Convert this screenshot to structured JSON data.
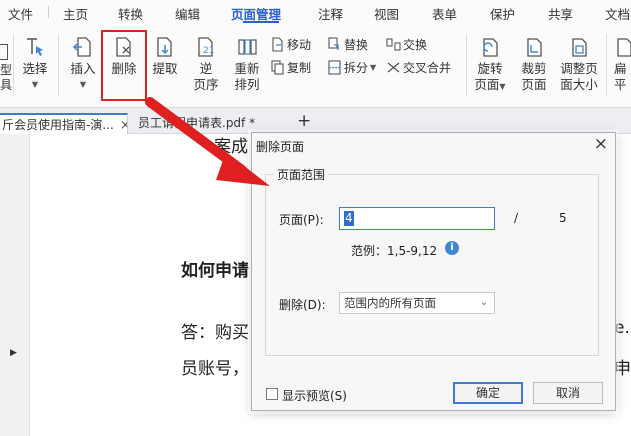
{
  "menu": {
    "items": [
      "文件",
      "主页",
      "转换",
      "编辑",
      "页面管理",
      "注释",
      "视图",
      "表单",
      "保护",
      "共享",
      "文档"
    ],
    "active": "页面管理"
  },
  "ribbon": {
    "edge_labels": {
      "top": "型",
      "bottom": "具"
    },
    "select": "选择",
    "insert": "插入",
    "delete": "删除",
    "extract": "提取",
    "reverse": [
      "逆",
      "页序"
    ],
    "rearrange": [
      "重新",
      "排列"
    ],
    "move": "移动",
    "copy": "复制",
    "replace": "替换",
    "split": "拆分",
    "swap": "交换",
    "cross_merge": "交叉合并",
    "rotate": [
      "旋转",
      "页面"
    ],
    "crop": [
      "裁剪",
      "页面"
    ],
    "resize": [
      "调整页",
      "面大小"
    ],
    "right_edge": [
      "扁",
      "平"
    ]
  },
  "tabs": [
    {
      "label": "斤会员使用指南-演...",
      "close": "×"
    },
    {
      "label": "员工请假申请表.pdf *",
      "close": "×"
    }
  ],
  "new_tab": "+",
  "document": {
    "heading_fragment": "案成",
    "question_fragment": "如何申请",
    "answer_line1": "答：购买",
    "answer_line2": "员账号，",
    "right_fragment1": "e.",
    "right_fragment2": "申请"
  },
  "dialog": {
    "title": "删除页面",
    "close": "×",
    "group_label": "页面范围",
    "page_label": "页面(P):",
    "page_value": "4",
    "slash": "/",
    "total": "5",
    "example": "范例：1,5-9,12",
    "info_icon": "i",
    "delete_label": "删除(D):",
    "delete_option": "范围内的所有页面",
    "preview": "显示预览(S)",
    "ok": "确定",
    "cancel": "取消"
  },
  "colors": {
    "accent": "#2b62c9",
    "highlight": "#e02020"
  }
}
